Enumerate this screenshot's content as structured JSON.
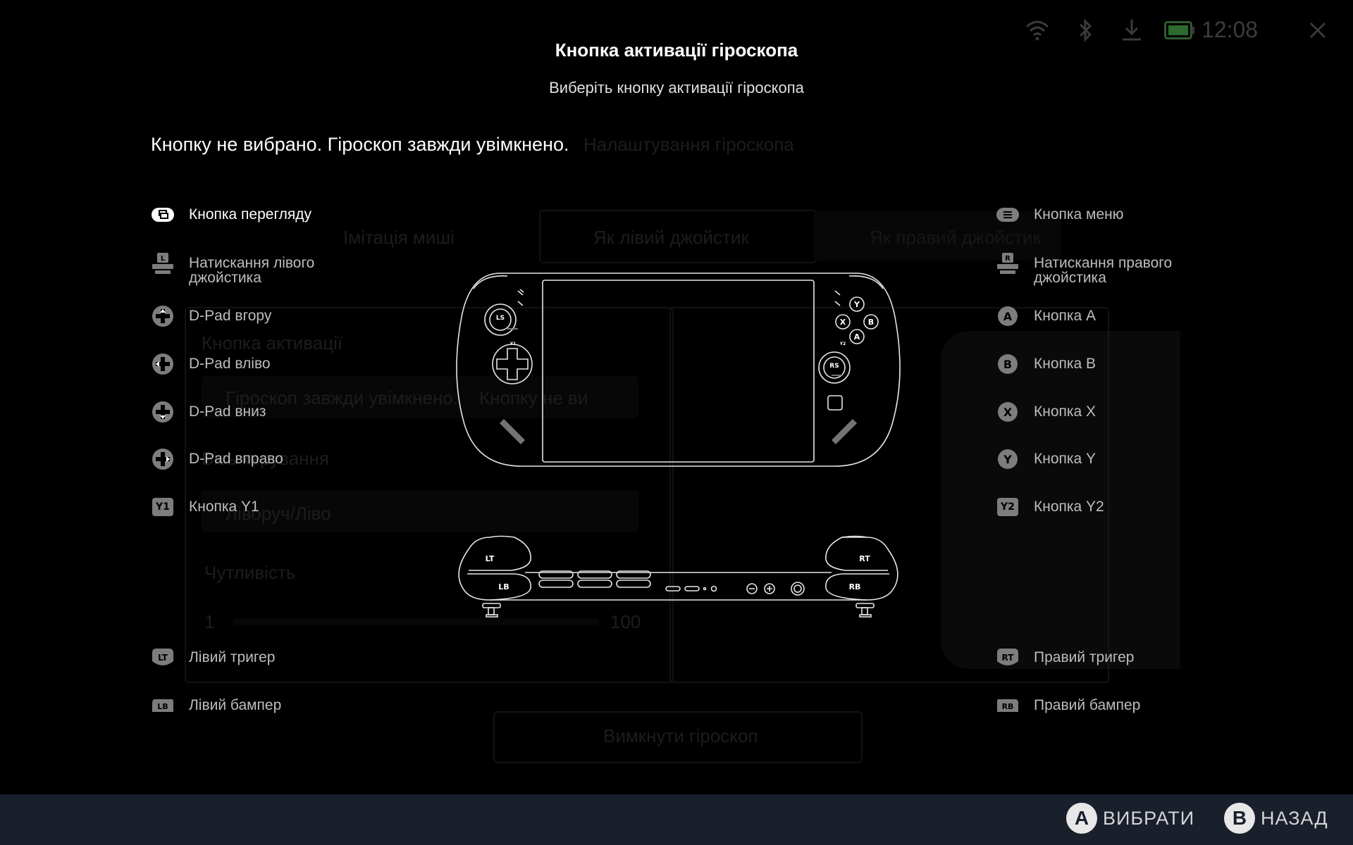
{
  "title": "Кнопка активації гіроскопа",
  "subtitle": "Виберіть кнопку активації гіроскопа",
  "status_message": "Кнопку не вибрано. Гіроскоп завжди увімкнено.",
  "status_bar": {
    "time": "12:08",
    "icons": [
      "wifi-icon",
      "bluetooth-icon",
      "download-icon",
      "battery-icon",
      "close-icon"
    ]
  },
  "background": {
    "heading": "Налаштування гіроскопа",
    "tabs": [
      "Імітація миші",
      "Як лівий джойстик",
      "Як правий джойстик"
    ],
    "activation_label": "Кнопка активації",
    "activation_options": [
      "Гіроскоп завжди увімкнено.",
      "Кнопку не ви"
    ],
    "direction_label": "Вісь керування",
    "direction_value": "Ліворуч/Ліво",
    "sensitivity_label": "Чутливість",
    "slider_min": "1",
    "slider_max": "100",
    "disable_button": "Вимкнути гіроскоп"
  },
  "left_options": [
    {
      "label": "Кнопка перегляду",
      "icon": "view-button-icon",
      "badge": "",
      "selected": true
    },
    {
      "label": "Натискання лівого джойстика",
      "icon": "left-stick-press-icon",
      "badge": "L",
      "selected": false
    },
    {
      "label": "D-Pad вгору",
      "icon": "dpad-up-icon",
      "badge": "",
      "selected": false
    },
    {
      "label": "D-Pad вліво",
      "icon": "dpad-left-icon",
      "badge": "",
      "selected": false
    },
    {
      "label": "D-Pad вниз",
      "icon": "dpad-down-icon",
      "badge": "",
      "selected": false
    },
    {
      "label": "D-Pad вправо",
      "icon": "dpad-right-icon",
      "badge": "",
      "selected": false
    },
    {
      "label": "Кнопка Y1",
      "icon": "y1-button-icon",
      "badge": "Y1",
      "selected": false
    },
    {
      "label": "Лівий тригер",
      "icon": "left-trigger-icon",
      "badge": "LT",
      "selected": false
    },
    {
      "label": "Лівий бампер",
      "icon": "left-bumper-icon",
      "badge": "LB",
      "selected": false
    }
  ],
  "right_options": [
    {
      "label": "Кнопка меню",
      "icon": "menu-button-icon",
      "badge": "",
      "selected": false
    },
    {
      "label": "Натискання правого джойстика",
      "icon": "right-stick-press-icon",
      "badge": "R",
      "selected": false
    },
    {
      "label": "Кнопка A",
      "icon": "a-button-icon",
      "badge": "A",
      "selected": false
    },
    {
      "label": "Кнопка B",
      "icon": "b-button-icon",
      "badge": "B",
      "selected": false
    },
    {
      "label": "Кнопка X",
      "icon": "x-button-icon",
      "badge": "X",
      "selected": false
    },
    {
      "label": "Кнопка Y",
      "icon": "y-button-icon",
      "badge": "Y",
      "selected": false
    },
    {
      "label": "Кнопка Y2",
      "icon": "y2-button-icon",
      "badge": "Y2",
      "selected": false
    },
    {
      "label": "Правий тригер",
      "icon": "right-trigger-icon",
      "badge": "RT",
      "selected": false
    },
    {
      "label": "Правий бампер",
      "icon": "right-bumper-icon",
      "badge": "RB",
      "selected": false
    }
  ],
  "device_labels": {
    "ls": "LS",
    "rs": "RS",
    "y1": "Y1",
    "y2": "Y2",
    "y": "Y",
    "x": "X",
    "b": "B",
    "a": "A",
    "lt": "LT",
    "lb": "LB",
    "rt": "RT",
    "rb": "RB"
  },
  "footer": {
    "select_key": "A",
    "select_label": "ВИБРАТИ",
    "back_key": "B",
    "back_label": "НАЗАД"
  }
}
